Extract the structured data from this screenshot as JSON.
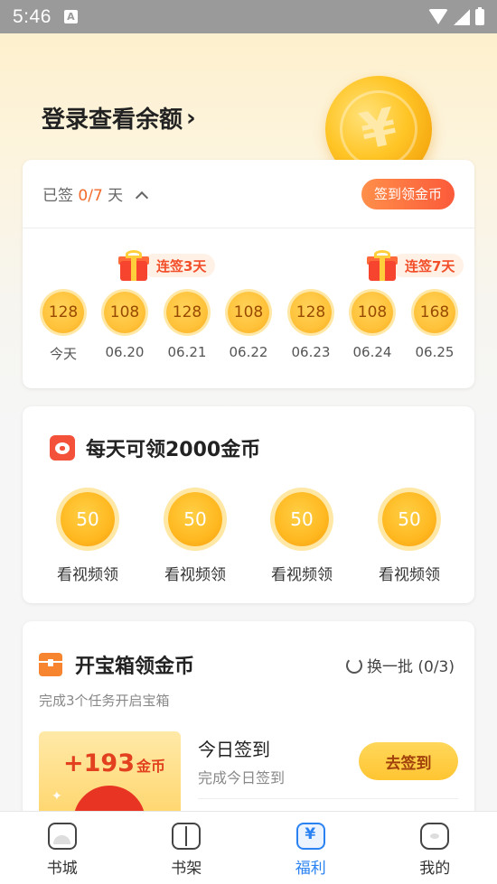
{
  "status_bar": {
    "time": "5:46",
    "notif_letter": "A"
  },
  "header": {
    "login_text": "登录查看余额",
    "login_chevron": "›",
    "coin_symbol": "¥"
  },
  "sign_in": {
    "signed_prefix": "已签",
    "signed_count": "0/7",
    "signed_suffix": "天",
    "button_label": "签到领金币",
    "streak_tags": [
      {
        "label": "连签3天"
      },
      {
        "label": "连签7天"
      }
    ],
    "days": [
      {
        "coins": "128",
        "date": "今天"
      },
      {
        "coins": "108",
        "date": "06.20"
      },
      {
        "coins": "128",
        "date": "06.21"
      },
      {
        "coins": "108",
        "date": "06.22"
      },
      {
        "coins": "128",
        "date": "06.23"
      },
      {
        "coins": "108",
        "date": "06.24"
      },
      {
        "coins": "168",
        "date": "06.25"
      }
    ]
  },
  "daily_video": {
    "title": "每天可领2000金币",
    "rewards": [
      {
        "coins": "50",
        "label": "看视频领"
      },
      {
        "coins": "50",
        "label": "看视频领"
      },
      {
        "coins": "50",
        "label": "看视频领"
      },
      {
        "coins": "50",
        "label": "看视频领"
      }
    ]
  },
  "treasure": {
    "title": "开宝箱领金币",
    "refresh_label": "换一批 (0/3)",
    "subtitle": "完成3个任务开启宝箱",
    "bonus_amount": "+193",
    "bonus_unit": "金币",
    "task": {
      "title": "今日签到",
      "subtitle": "完成今日签到",
      "button_label": "去签到"
    }
  },
  "tabbar": {
    "tabs": [
      {
        "label": "书城",
        "icon": "bookstore-icon"
      },
      {
        "label": "书架",
        "icon": "bookshelf-icon"
      },
      {
        "label": "福利",
        "icon": "welfare-icon",
        "active": true
      },
      {
        "label": "我的",
        "icon": "profile-icon"
      }
    ]
  },
  "colors": {
    "accent_orange": "#f26b2a",
    "tab_active": "#2a82f2",
    "coin_gold": "#ffc23a"
  }
}
